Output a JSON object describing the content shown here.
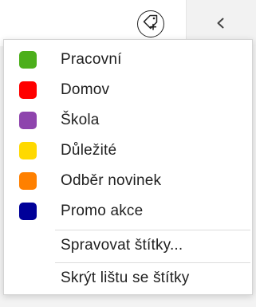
{
  "toolbar": {
    "tag_button_icon": "tag-add-icon",
    "collapse_icon": "chevron-left-icon"
  },
  "menu": {
    "tags": [
      {
        "label": "Pracovní",
        "color": "#4caf1b"
      },
      {
        "label": "Domov",
        "color": "#ff0000"
      },
      {
        "label": "Škola",
        "color": "#8e44ad"
      },
      {
        "label": "Důležité",
        "color": "#ffd900"
      },
      {
        "label": "Odběr novinek",
        "color": "#ff8000"
      },
      {
        "label": "Promo akce",
        "color": "#000099"
      }
    ],
    "manage_label": "Spravovat štítky...",
    "hide_label": "Skrýt lištu se štítky"
  }
}
